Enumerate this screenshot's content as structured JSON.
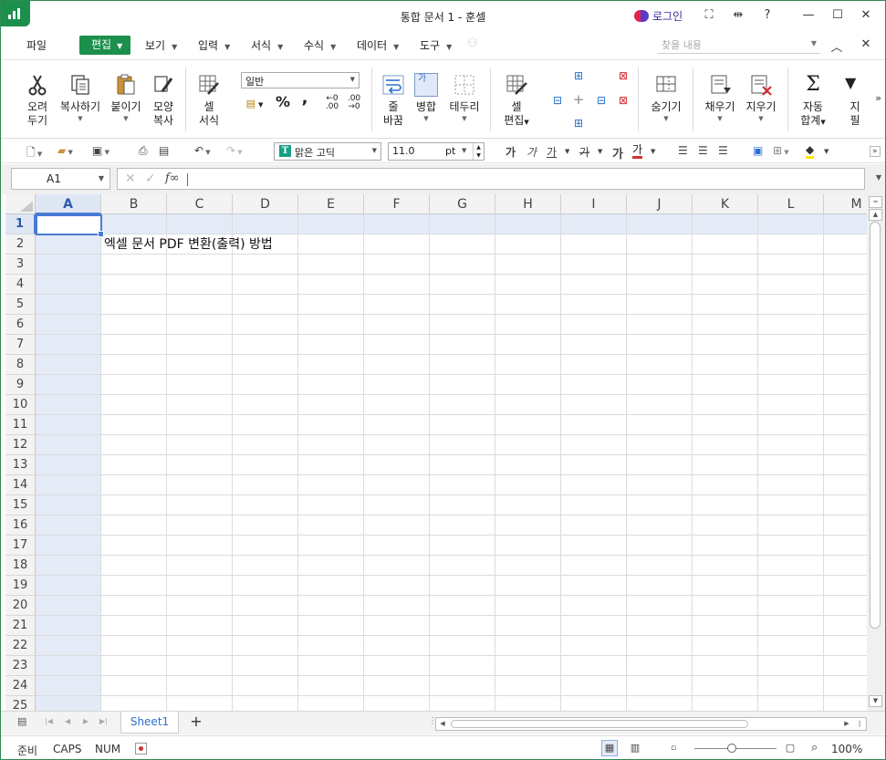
{
  "window": {
    "title": "통합 문서 1 - 훈셀",
    "login_label": "로그인",
    "controls": [
      "⛶",
      "⇹",
      "?",
      "—",
      "☐",
      "✕"
    ]
  },
  "menu": {
    "file": "파일",
    "edit": "편집",
    "view": "보기",
    "insert": "입력",
    "format": "서식",
    "formula": "수식",
    "data": "데이터",
    "tools": "도구",
    "search_placeholder": "찾을 내용"
  },
  "ribbon": {
    "cut": [
      "오려",
      "두기"
    ],
    "copy": "복사하기",
    "paste": "붙이기",
    "format_copy": [
      "모양",
      "복사"
    ],
    "cell_format": [
      "셀",
      "서식"
    ],
    "number_format": "일반",
    "percent": "%",
    "comma": ",",
    "wrap": [
      "줄",
      "바꿈"
    ],
    "merge": "병합",
    "merge_icon_label": "가",
    "border": "테두리",
    "cell_edit": [
      "셀",
      "편집"
    ],
    "hide": "숨기기",
    "fill": "채우기",
    "clear": "지우기",
    "autosum": [
      "자동",
      "합계"
    ],
    "filter_partial": [
      "지",
      "필"
    ],
    "more": "»"
  },
  "format_toolbar": {
    "font_name": "맑은 고딕",
    "font_icon": "T",
    "font_size": "11.0",
    "font_unit": "pt",
    "bold": "가",
    "italic": "가",
    "underline": "가",
    "strike": "가",
    "grow": "가",
    "color": "가"
  },
  "formula_bar": {
    "name_box": "A1",
    "cancel": "✕",
    "confirm": "✓",
    "fx": "f∞",
    "value": ""
  },
  "sheet": {
    "columns": [
      "A",
      "B",
      "C",
      "D",
      "E",
      "F",
      "G",
      "H",
      "I",
      "J",
      "K",
      "L",
      "M"
    ],
    "rows": [
      "1",
      "2",
      "3",
      "4",
      "5",
      "6",
      "7",
      "8",
      "9",
      "10",
      "11",
      "12",
      "13",
      "14",
      "15",
      "16",
      "17",
      "18",
      "19",
      "20",
      "21",
      "22",
      "23",
      "24",
      "25"
    ],
    "selected_cell": "A1",
    "cells": {
      "B2": "엑셀 문서 PDF 변환(출력) 방법"
    }
  },
  "tabs": {
    "sheets": [
      "Sheet1"
    ],
    "active": "Sheet1",
    "add": "+"
  },
  "status": {
    "ready": "준비",
    "caps": "CAPS",
    "num": "NUM",
    "zoom": "100%"
  },
  "colors": {
    "brand": "#1d8f4c",
    "selection": "#4a7bd4",
    "header_selected": "#dfe7f5",
    "sheet_tab_text": "#2b6fd0"
  }
}
